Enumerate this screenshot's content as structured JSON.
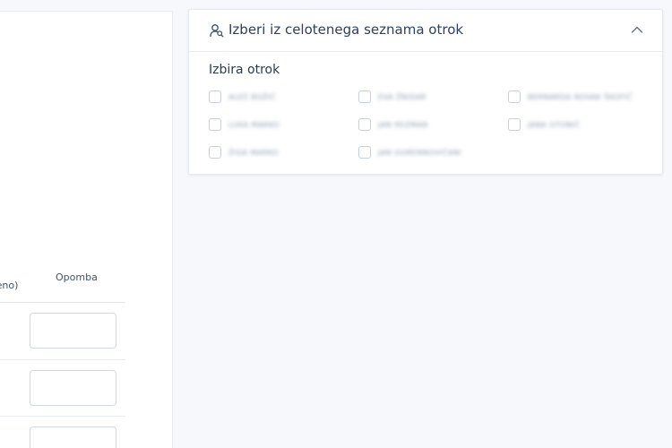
{
  "left_panel": {
    "column_left_label": "ten\nvičeno)",
    "column_note_label": "Opomba"
  },
  "right_panel": {
    "title": "Izberi iz celotenega seznama otrok",
    "section_label": "Izbira otrok",
    "children": [
      {
        "name": "ALEŠ BOŽIČ",
        "checked": false
      },
      {
        "name": "EVA ŽNIDAR",
        "checked": false
      },
      {
        "name": "BERNARDA NOVAK ŠKOFIČ",
        "checked": false
      },
      {
        "name": "LUKA MARKO",
        "checked": false
      },
      {
        "name": "JAN REZMAN",
        "checked": false
      },
      {
        "name": "JANA OTONIČ",
        "checked": false
      },
      {
        "name": "ŽIGA MARKO",
        "checked": false
      },
      {
        "name": "JAN GORENNOVIČANI",
        "checked": false
      }
    ]
  },
  "colors": {
    "accent": "#2e3f5f",
    "border": "#e6eaf0",
    "background": "#f6f8fb"
  }
}
